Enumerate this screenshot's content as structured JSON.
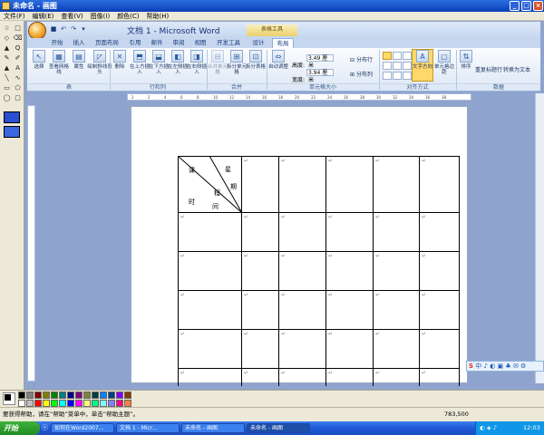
{
  "paint": {
    "title": "未命名 - 画图",
    "window_buttons": {
      "min": "_",
      "max": "□",
      "close": "×"
    },
    "menu": [
      "文件(F)",
      "编辑(E)",
      "查看(V)",
      "图像(I)",
      "颜色(C)",
      "帮助(H)"
    ],
    "tools": [
      "☆",
      "□",
      "◇",
      "⌫",
      "▲",
      "Q",
      "✎",
      "✐",
      "▲",
      "A",
      "╲",
      "∿",
      "▭",
      "⬠",
      "◯",
      "▢"
    ],
    "palette": [
      "#000000",
      "#808080",
      "#800000",
      "#808000",
      "#008000",
      "#008080",
      "#000080",
      "#800080",
      "#808040",
      "#004040",
      "#0080ff",
      "#004080",
      "#8000ff",
      "#804000",
      "#ffffff",
      "#c0c0c0",
      "#ff0000",
      "#ffff00",
      "#00ff00",
      "#00ffff",
      "#0000ff",
      "#ff00ff",
      "#ffff80",
      "#00ff80",
      "#80ffff",
      "#8080ff",
      "#ff0080",
      "#ff8040"
    ],
    "status": {
      "help_text": "要获得帮助，请在“帮助”菜单中，单击“帮助主题”。",
      "coords": "783,500"
    }
  },
  "word": {
    "title": "文档 1 - Microsoft Word",
    "context_label": "表格工具",
    "tabs": [
      "开始",
      "插入",
      "页面布局",
      "引用",
      "邮件",
      "审阅",
      "视图",
      "开发工具",
      "设计",
      "布局"
    ],
    "active_tab": "布局",
    "ribbon": {
      "select": "选择",
      "view_gridlines": "查看网格线",
      "properties": "属性",
      "draw_diagonal": "绘制斜线表头",
      "delete": "删除",
      "insert_above": "在上方插入",
      "insert_below": "在下方插入",
      "insert_left": "在左侧插入",
      "insert_right": "在右侧插入",
      "merge_cells": "合并单元格",
      "split_cells": "拆分单元格",
      "split_table": "拆分表格",
      "autofit": "自动调整",
      "height_label": "高度:",
      "height_value": "3.49 厘米",
      "width_label": "宽度:",
      "width_value": "3.94 厘米",
      "distribute_rows": "分布行",
      "distribute_cols": "分布列",
      "text_direction": "文字方向",
      "cell_margins": "单元格边距",
      "sort": "排序",
      "repeat_header": "重复标题行",
      "convert_to_text": "转换为文本",
      "groups": {
        "table": "表",
        "rows_cols": "行和列",
        "merge": "合并",
        "cell_size": "单元格大小",
        "alignment": "对齐方式",
        "data": "数据"
      }
    },
    "ruler_marks": [
      "2",
      "2",
      "4",
      "6",
      "8",
      "10",
      "12",
      "14",
      "16",
      "18",
      "20",
      "22",
      "24",
      "26",
      "28",
      "30",
      "32",
      "34",
      "36",
      "38"
    ],
    "table_header": {
      "ke": "课",
      "xing": "星",
      "qi": "期",
      "cheng": "程",
      "shi": "时",
      "jian": "间"
    }
  },
  "taskbar": {
    "start": "开始",
    "tasks": [
      "如何在Word2007...",
      "文档 1 - Micr...",
      "未命名 - 画图",
      "未命名 - 画图"
    ],
    "time": "12:03"
  },
  "ime": {
    "text": "中 ♪ ◐ ▣ ♣ ✉ ⚙"
  }
}
